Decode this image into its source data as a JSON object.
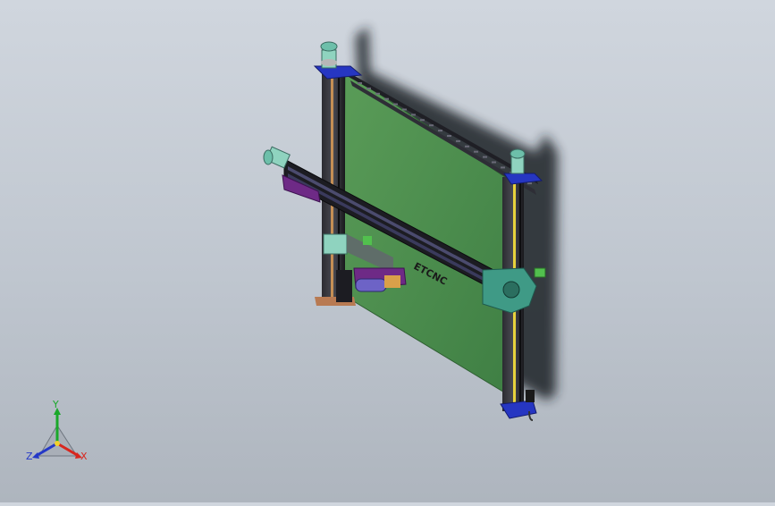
{
  "viewport": {
    "model_marking": "ETCNC"
  },
  "triad": {
    "y_label": "Y",
    "x_label": "X",
    "z_label": "Z",
    "y_color": "#1aa82a",
    "x_color": "#d8261e",
    "z_color": "#2438c8"
  },
  "colors": {
    "panel": "#4f8f4f",
    "frame": "#1e1e24",
    "plate_blue": "#2636c2",
    "plate_purple": "#6e2a86",
    "plate_teal": "#3f9a86",
    "motor": "#8fd3bf",
    "shadow": "#20242a"
  }
}
